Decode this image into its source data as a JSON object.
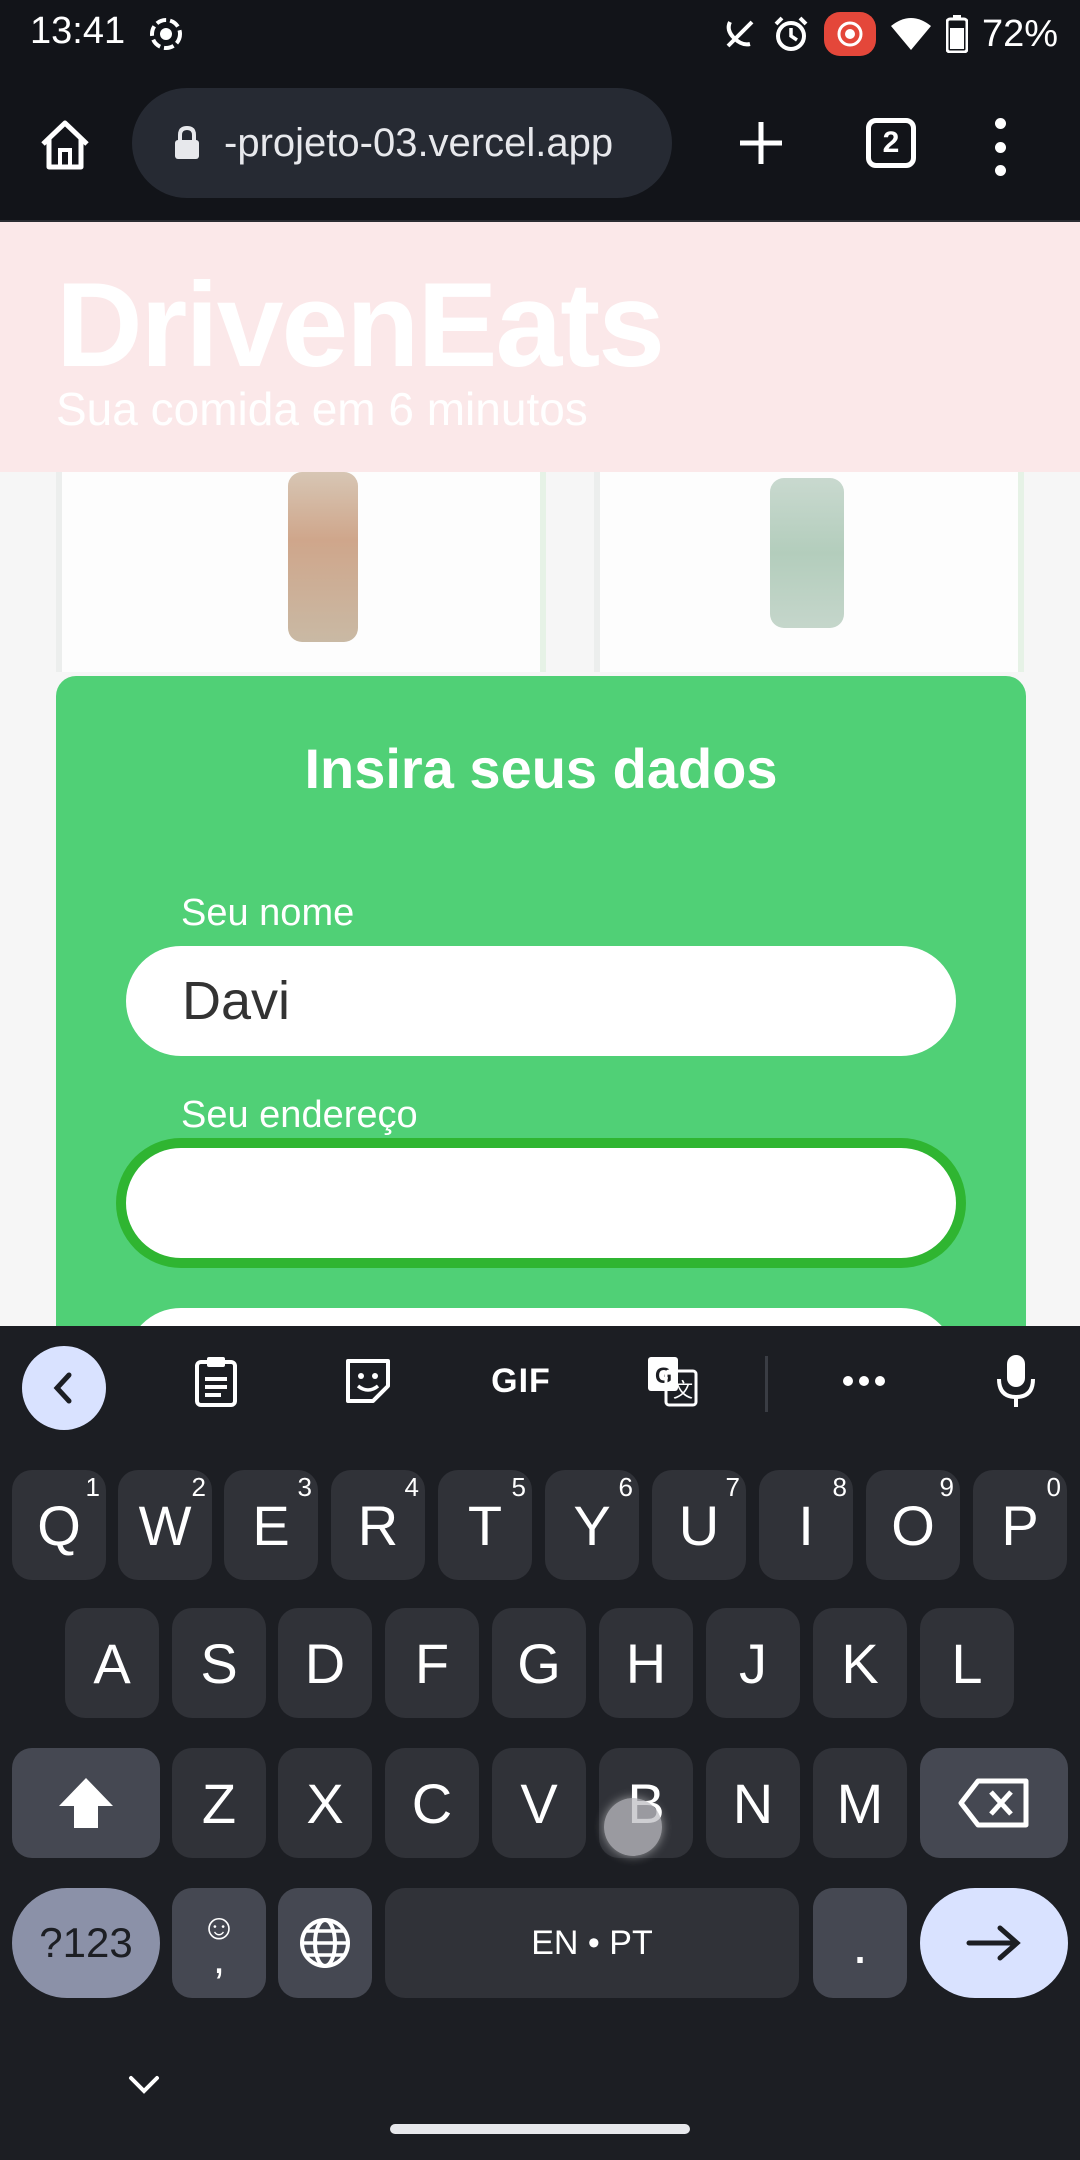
{
  "status_bar": {
    "time": "13:41",
    "battery": "72%",
    "icons": [
      "screen-record-icon",
      "mute-icon",
      "alarm-icon",
      "recording-badge-icon",
      "wifi-icon",
      "battery-icon"
    ]
  },
  "browser": {
    "url": "-projeto-03.vercel.app",
    "tab_count": "2"
  },
  "site": {
    "logo": "DrivenEats",
    "tagline": "Sua comida em 6 minutos"
  },
  "form": {
    "title": "Insira seus dados",
    "name_label": "Seu nome",
    "name_value": "Davi",
    "address_label": "Seu endereço",
    "address_value": ""
  },
  "keyboard": {
    "toolbar": [
      "back",
      "clipboard",
      "sticker",
      "GIF",
      "translate",
      "more",
      "mic"
    ],
    "gif_label": "GIF",
    "row1": [
      {
        "k": "Q",
        "h": "1"
      },
      {
        "k": "W",
        "h": "2"
      },
      {
        "k": "E",
        "h": "3"
      },
      {
        "k": "R",
        "h": "4"
      },
      {
        "k": "T",
        "h": "5"
      },
      {
        "k": "Y",
        "h": "6"
      },
      {
        "k": "U",
        "h": "7"
      },
      {
        "k": "I",
        "h": "8"
      },
      {
        "k": "O",
        "h": "9"
      },
      {
        "k": "P",
        "h": "0"
      }
    ],
    "row2": [
      "A",
      "S",
      "D",
      "F",
      "G",
      "H",
      "J",
      "K",
      "L"
    ],
    "row3": [
      "Z",
      "X",
      "C",
      "V",
      "B",
      "N",
      "M"
    ],
    "symbols_key": "?123",
    "emoji_comma_key": "☺\n,",
    "space_label": "EN • PT",
    "period_key": "."
  },
  "colors": {
    "modal_green": "#50d076",
    "focus_ring": "#2fb531",
    "header_pink": "#fbe8e9",
    "keyboard_bg": "#1c1e23",
    "key_bg": "#303238",
    "accent_key": "#d9e2ff"
  }
}
